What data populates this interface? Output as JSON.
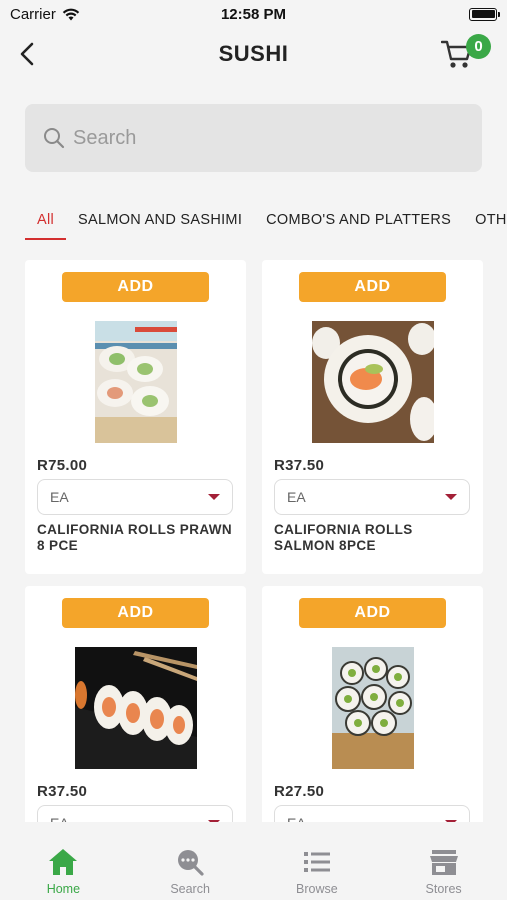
{
  "status_bar": {
    "carrier": "Carrier",
    "time": "12:58 PM"
  },
  "header": {
    "title": "SUSHI",
    "cart_count": "0"
  },
  "search": {
    "placeholder": "Search"
  },
  "tabs": [
    {
      "label": "All",
      "active": true
    },
    {
      "label": "SALMON AND SASHIMI"
    },
    {
      "label": "COMBO'S AND PLATTERS"
    },
    {
      "label": "OTHER"
    }
  ],
  "products": [
    {
      "add_label": "ADD",
      "price": "R75.00",
      "uom": "EA",
      "name": "CALIFORNIA ROLLS PRAWN 8 PCE"
    },
    {
      "add_label": "ADD",
      "price": "R37.50",
      "uom": "EA",
      "name": "CALIFORNIA ROLLS SALMON 8PCE"
    },
    {
      "add_label": "ADD",
      "price": "R37.50",
      "uom": "EA",
      "name": ""
    },
    {
      "add_label": "ADD",
      "price": "R27.50",
      "uom": "EA",
      "name": ""
    }
  ],
  "bottom_nav": [
    {
      "label": "Home",
      "icon": "home-icon",
      "active": true
    },
    {
      "label": "Search",
      "icon": "search-icon"
    },
    {
      "label": "Browse",
      "icon": "list-icon"
    },
    {
      "label": "Stores",
      "icon": "store-icon"
    }
  ],
  "colors": {
    "accent": "#f4a52a",
    "active_tab": "#d32f2f",
    "brand_green": "#3aa847",
    "caret": "#a32037"
  }
}
